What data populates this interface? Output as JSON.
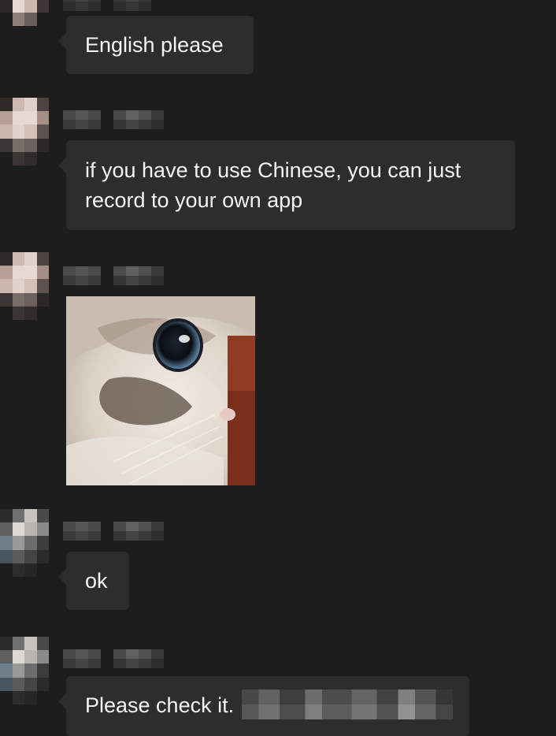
{
  "messages": [
    {
      "type": "text",
      "text": "English please"
    },
    {
      "type": "text",
      "text": "if you have to use Chinese, you can just record to your own app"
    },
    {
      "type": "image",
      "description_icon": "cat-photo"
    },
    {
      "type": "text",
      "text": "ok"
    },
    {
      "type": "text",
      "text": "Please check it."
    }
  ],
  "colors": {
    "background": "#1d1d1d",
    "bubble": "#2d2d2d",
    "text": "#f4f4f4"
  }
}
